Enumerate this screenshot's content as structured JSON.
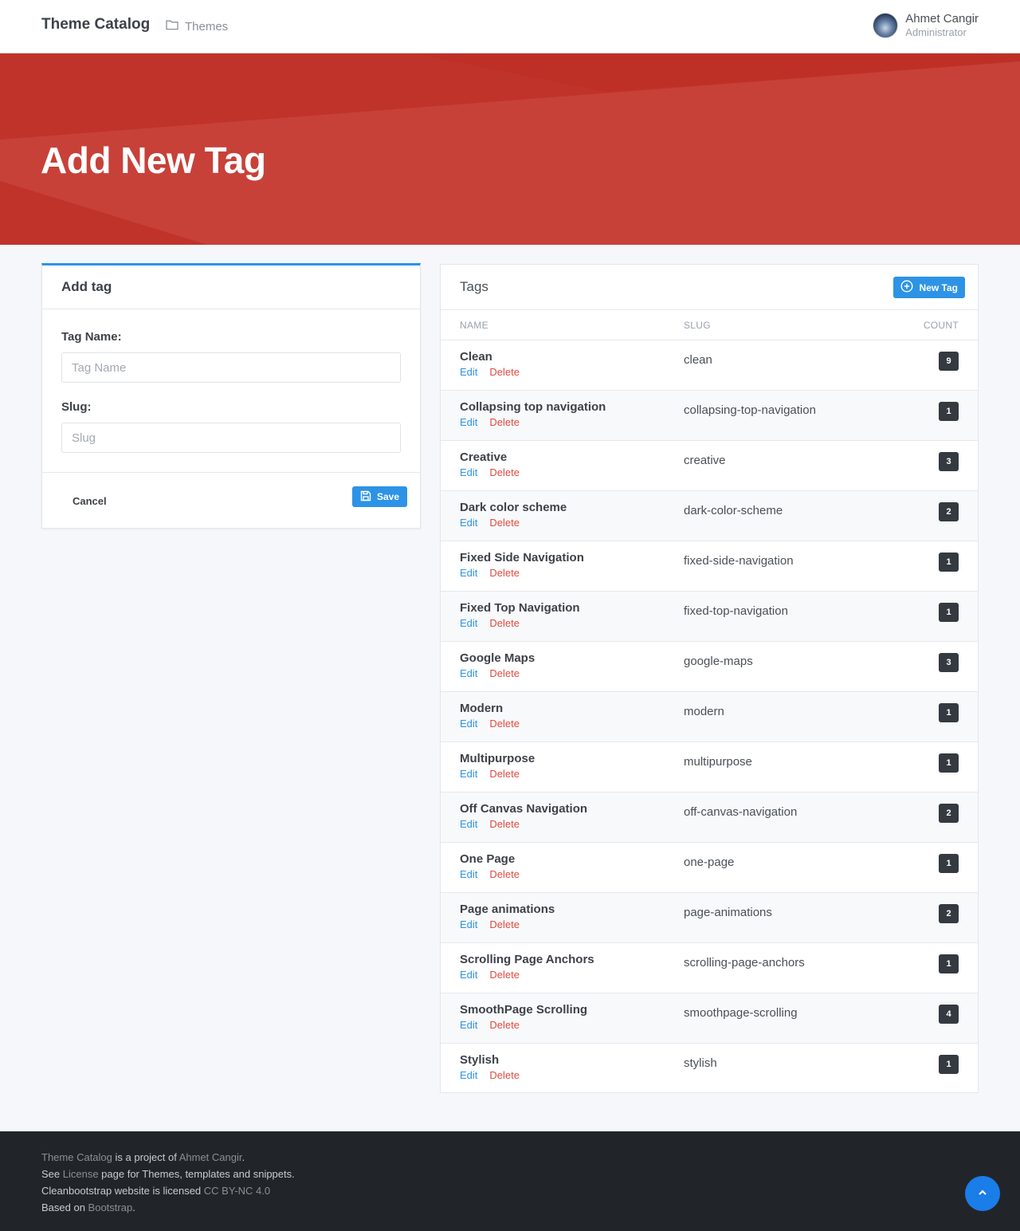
{
  "navbar": {
    "brand": "Theme Catalog",
    "nav_link": "Themes",
    "user_name": "Ahmet Cangir",
    "user_role": "Administrator"
  },
  "hero": {
    "title": "Add New Tag"
  },
  "add_form": {
    "title": "Add tag",
    "tag_name_label": "Tag Name:",
    "tag_name_placeholder": "Tag Name",
    "tag_name_value": "",
    "slug_label": "Slug:",
    "slug_placeholder": "Slug",
    "slug_value": "",
    "cancel_label": "Cancel",
    "save_label": "Save"
  },
  "tags": {
    "title": "Tags",
    "new_button_label": "New Tag",
    "columns": {
      "name": "NAME",
      "slug": "SLUG",
      "count": "COUNT"
    },
    "edit_label": "Edit",
    "delete_label": "Delete",
    "rows": [
      {
        "name": "Clean",
        "slug": "clean",
        "count": "9"
      },
      {
        "name": "Collapsing top navigation",
        "slug": "collapsing-top-navigation",
        "count": "1"
      },
      {
        "name": "Creative",
        "slug": "creative",
        "count": "3"
      },
      {
        "name": "Dark color scheme",
        "slug": "dark-color-scheme",
        "count": "2"
      },
      {
        "name": "Fixed Side Navigation",
        "slug": "fixed-side-navigation",
        "count": "1"
      },
      {
        "name": "Fixed Top Navigation",
        "slug": "fixed-top-navigation",
        "count": "1"
      },
      {
        "name": "Google Maps",
        "slug": "google-maps",
        "count": "3"
      },
      {
        "name": "Modern",
        "slug": "modern",
        "count": "1"
      },
      {
        "name": "Multipurpose",
        "slug": "multipurpose",
        "count": "1"
      },
      {
        "name": "Off Canvas Navigation",
        "slug": "off-canvas-navigation",
        "count": "2"
      },
      {
        "name": "One Page",
        "slug": "one-page",
        "count": "1"
      },
      {
        "name": "Page animations",
        "slug": "page-animations",
        "count": "2"
      },
      {
        "name": "Scrolling Page Anchors",
        "slug": "scrolling-page-anchors",
        "count": "1"
      },
      {
        "name": "SmoothPage Scrolling",
        "slug": "smoothpage-scrolling",
        "count": "4"
      },
      {
        "name": "Stylish",
        "slug": "stylish",
        "count": "1"
      }
    ]
  },
  "footer": {
    "line1_link1": "Theme Catalog",
    "line1_text": " is a project of ",
    "line1_link2": "Ahmet Cangir",
    "line1_end": ".",
    "line2_start": "See ",
    "line2_link": "License",
    "line2_end": " page for Themes, templates and snippets.",
    "line3_start": "Cleanbootstrap website is licensed ",
    "line3_link": "CC BY-NC 4.0",
    "line4_start": "Based on ",
    "line4_link": "Bootstrap",
    "line4_end": "."
  },
  "colors": {
    "hero_bg": "#c0332a",
    "primary": "#2d93e6",
    "danger": "#e04a3f",
    "footer_bg": "#212529"
  },
  "icons": {
    "nav_link": "folder-icon",
    "save": "floppy-disk-icon",
    "new_tag": "plus-circle-icon",
    "back_to_top": "chevron-up-icon"
  }
}
